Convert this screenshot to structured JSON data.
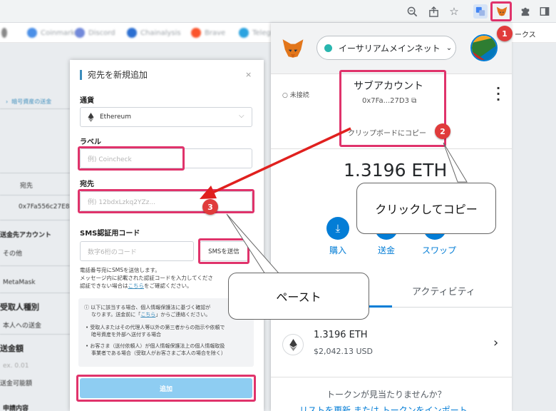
{
  "bookmarks": [
    "Coinmarket",
    "Discord",
    "Chainalysis",
    "Brave",
    "Telegram"
  ],
  "bookmark_tail": "ークス",
  "background_page": {
    "crumb": "暗号資産の送金",
    "to_label": "宛先",
    "address": "0x7Fa556c27E81",
    "section_type": "送金先アカウント",
    "other": "その他",
    "wallet": "MetaMask",
    "recipient_kind": "受取人種別",
    "self": "本人への送金",
    "amount": "送金額",
    "amount_placeholder": "ex. 0.01",
    "available": "送金可能額",
    "purpose": "申請内容"
  },
  "dialog": {
    "title": "宛先を新規追加",
    "close": "×",
    "currency_label": "通貨",
    "currency_value": "Ethereum",
    "label_label": "ラベル",
    "label_placeholder": "例) Coincheck",
    "address_label": "宛先",
    "address_placeholder": "例) 12bdxLzkq2YZz...",
    "sms_label": "SMS認証用コード",
    "sms_placeholder": "数字6桁のコード",
    "sms_button": "SMSを送信",
    "sms_note_1": "電話番号宛にSMSを送信します。",
    "sms_note_2": "メッセージ内に記載された認証コードを入力してくださ",
    "sms_note_3a": "認証できない場合は",
    "sms_note_link": "こちら",
    "sms_note_3b": "をご確認ください。",
    "info_1": "以下に該当する場合、個人情報保護法に基づく確認が",
    "info_2a": "なります。送金前に「",
    "info_link": "こちら",
    "info_2b": "」からご連絡ください。",
    "info_b1a": "受取人またはその代理人等以外の第三者からの指示や依頼で",
    "info_b1b": "暗号資産を外部へ送付する場合",
    "info_b2a": "お客さま（送付依頼人）が個人情報保護法上の個人情報取扱",
    "info_b2b": "事業者である場合（受取人がお客さまご本人の場合を除く）",
    "add_button": "追加"
  },
  "metamask": {
    "network": "イーサリアムメインネット",
    "status": "未接続",
    "account_name": "サブアカウント",
    "address_short": "0x7Fa...27D3",
    "copied_tooltip": "クリップボードにコピー",
    "balance": "1.3196 ETH",
    "actions": [
      "購入",
      "送金",
      "スワップ"
    ],
    "tab_activity": "アクティビティ",
    "asset_amount": "1.3196 ETH",
    "asset_usd": "$2,042.13 USD",
    "missing_tokens": "トークンが見当たりませんか？",
    "footer_links": "リストを更新 または トークンをインポート"
  },
  "callouts": {
    "copy": "クリックしてコピー",
    "paste": "ペースト"
  },
  "steps": [
    "1",
    "2",
    "3"
  ],
  "colors": {
    "highlight": "#e0336b",
    "badge": "#e03b3b",
    "metamask_blue": "#037dd6",
    "dialog_accent": "#3c8dbc",
    "add_button": "#8ecdf2"
  }
}
